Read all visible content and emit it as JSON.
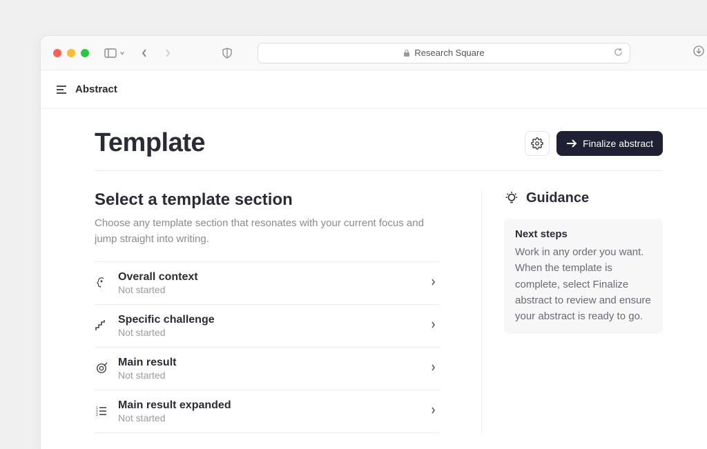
{
  "browser": {
    "site_name": "Research Square"
  },
  "header": {
    "breadcrumb": "Abstract"
  },
  "page": {
    "title": "Template",
    "primary_action": "Finalize abstract"
  },
  "select_section": {
    "title": "Select a template section",
    "description": "Choose any template section that resonates with your current focus and jump straight into writing."
  },
  "templates": [
    {
      "icon": "head-icon",
      "title": "Overall context",
      "status": "Not started"
    },
    {
      "icon": "steps-icon",
      "title": "Specific challenge",
      "status": "Not started"
    },
    {
      "icon": "target-icon",
      "title": "Main result",
      "status": "Not started"
    },
    {
      "icon": "list-ordered-icon",
      "title": "Main result expanded",
      "status": "Not started"
    }
  ],
  "guidance": {
    "title": "Guidance",
    "card_title": "Next steps",
    "card_body": "Work in any order you want. When the template is complete, select Finalize abstract to review and ensure your abstract is ready to go."
  }
}
